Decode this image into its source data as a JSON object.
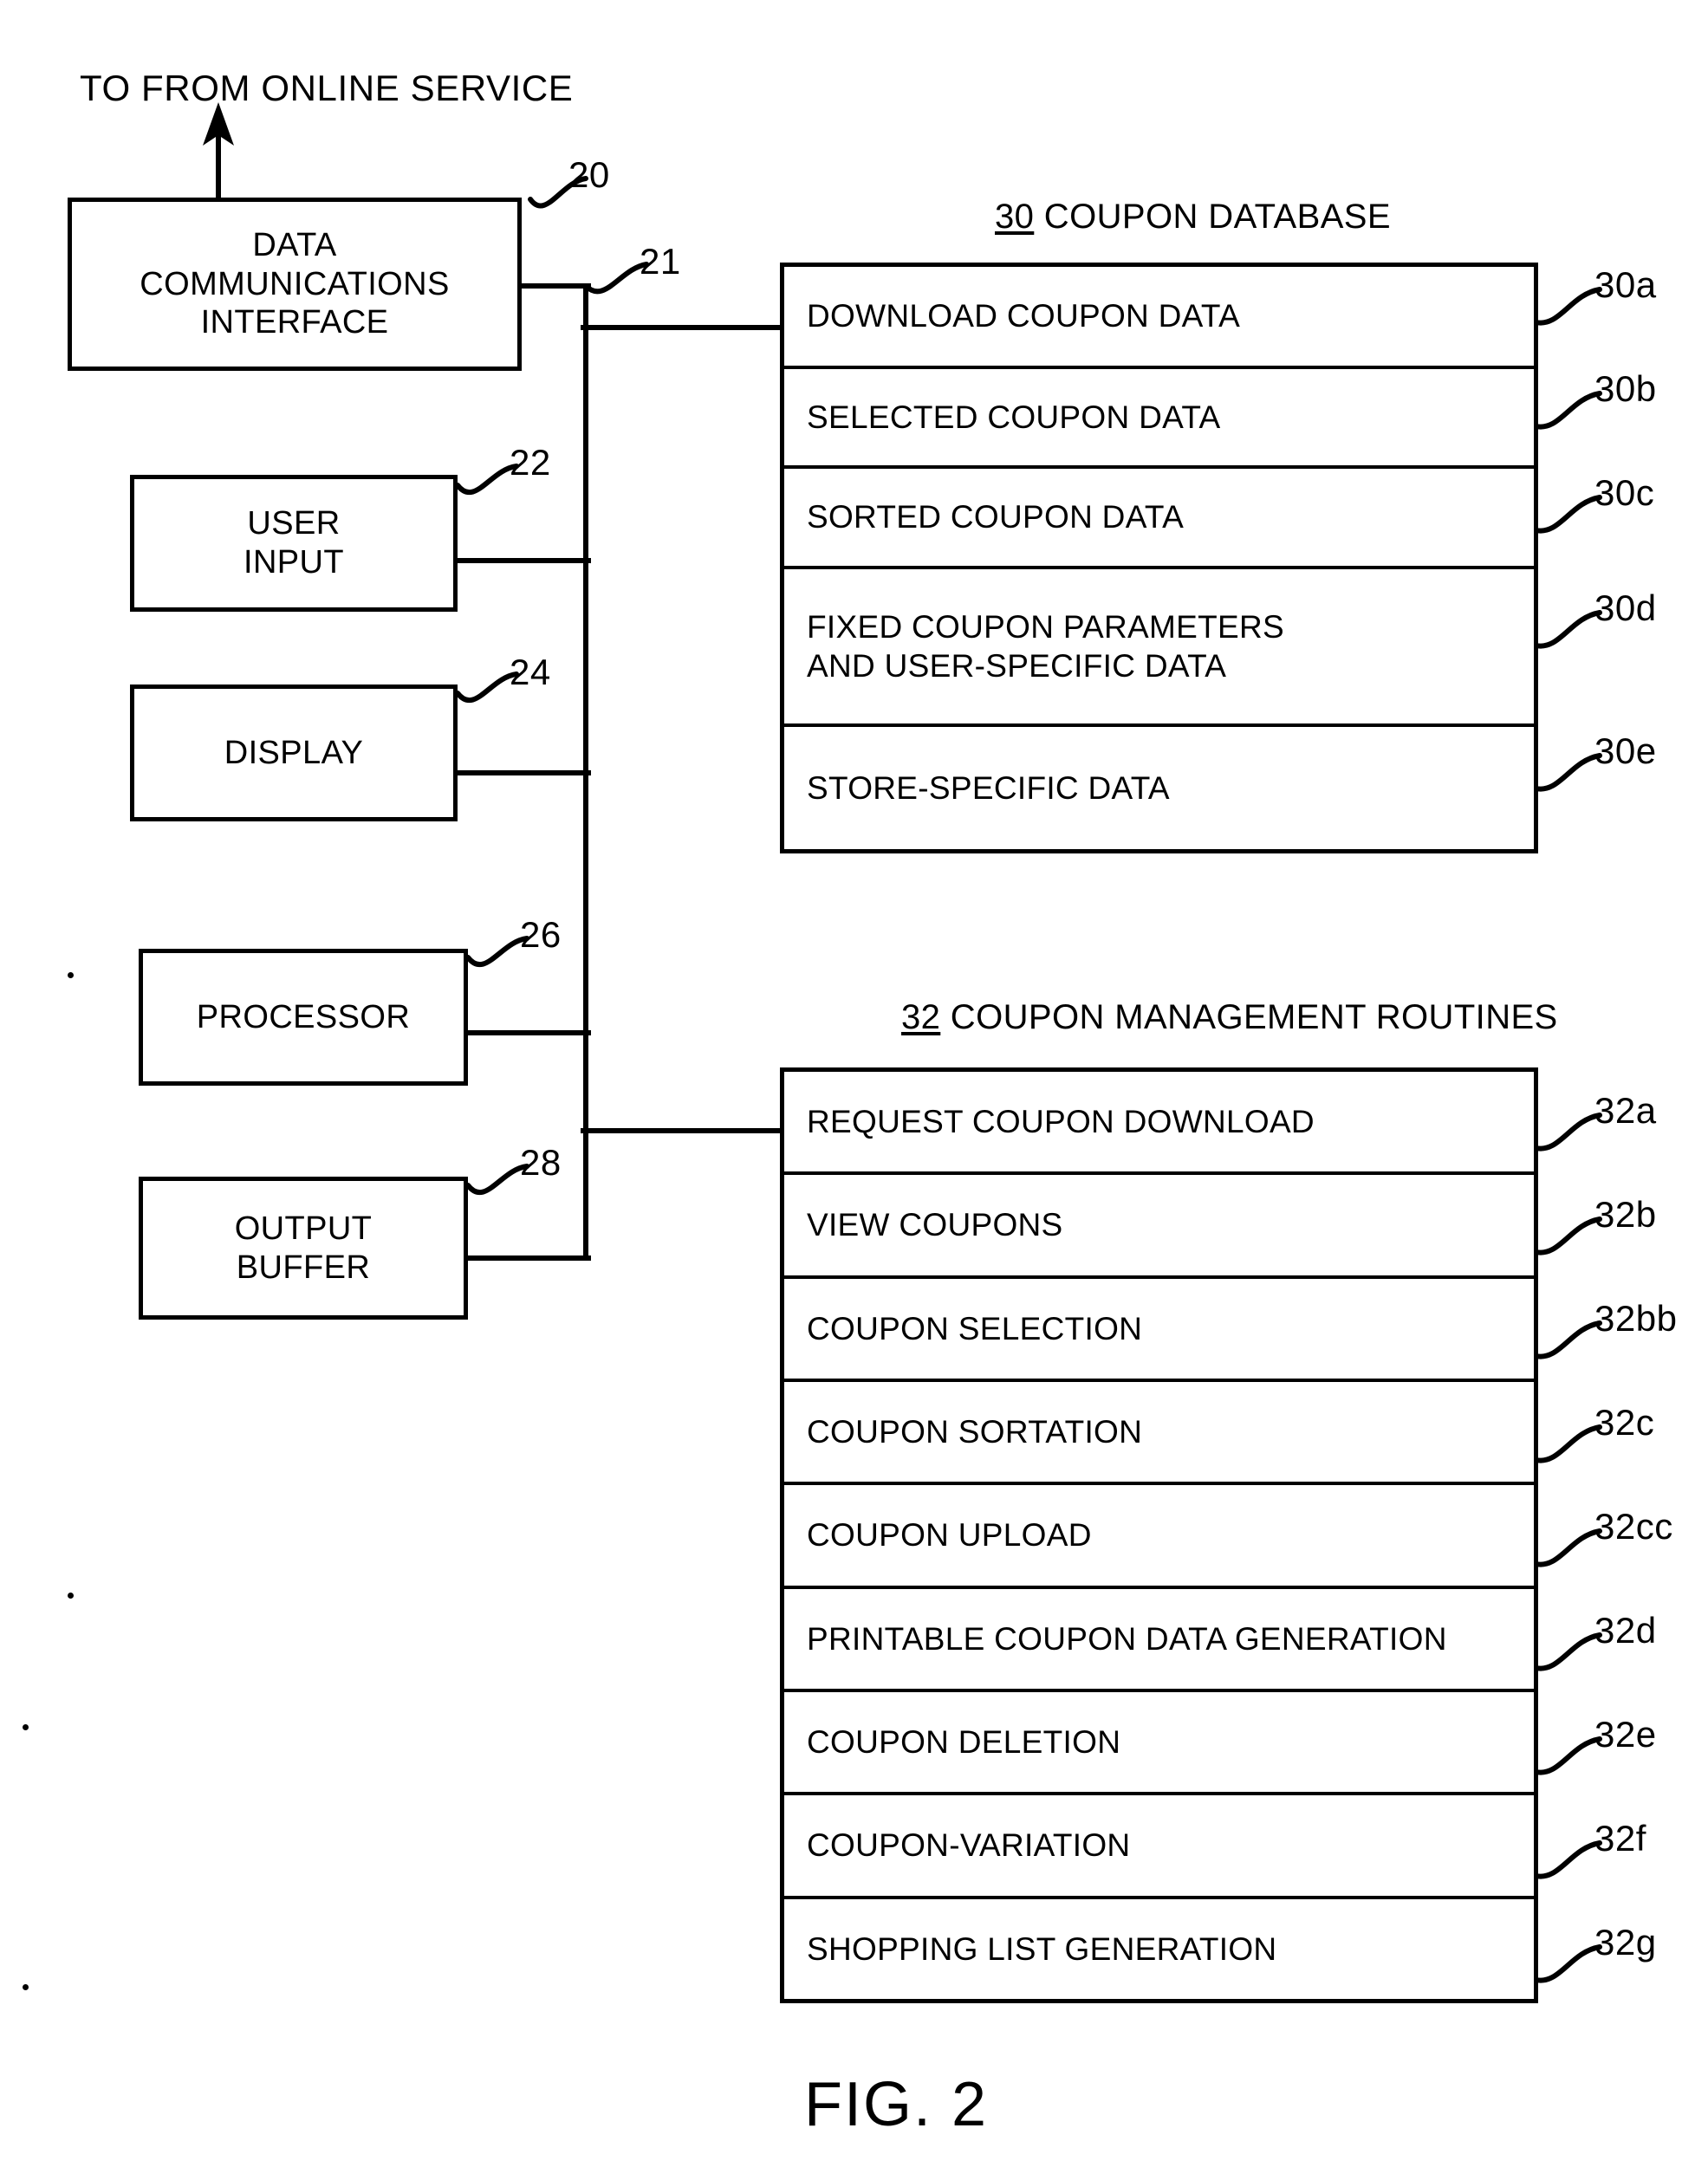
{
  "figure": {
    "caption": "FIG. 2",
    "top_annotation": "TO FROM ONLINE SERVICE"
  },
  "blocks": [
    {
      "id": "20",
      "label": "DATA\nCOMMUNICATIONS\nINTERFACE",
      "ref": "20"
    },
    {
      "id": "22",
      "label": "USER\nINPUT",
      "ref": "22"
    },
    {
      "id": "24",
      "label": "DISPLAY",
      "ref": "24"
    },
    {
      "id": "26",
      "label": "PROCESSOR",
      "ref": "26"
    },
    {
      "id": "28",
      "label": "OUTPUT\nBUFFER",
      "ref": "28"
    }
  ],
  "bus": {
    "ref": "21"
  },
  "coupon_database": {
    "header_number": "30",
    "header_text": " COUPON DATABASE",
    "rows": [
      {
        "label": "DOWNLOAD COUPON DATA",
        "ref": "30a"
      },
      {
        "label": "SELECTED COUPON DATA",
        "ref": "30b"
      },
      {
        "label": "SORTED COUPON DATA",
        "ref": "30c"
      },
      {
        "label": "FIXED COUPON PARAMETERS\nAND USER-SPECIFIC DATA",
        "ref": "30d"
      },
      {
        "label": "STORE-SPECIFIC DATA",
        "ref": "30e"
      }
    ]
  },
  "coupon_management_routines": {
    "header_number": "32",
    "header_text": " COUPON MANAGEMENT ROUTINES",
    "rows": [
      {
        "label": "REQUEST COUPON DOWNLOAD",
        "ref": "32a"
      },
      {
        "label": "VIEW COUPONS",
        "ref": "32b"
      },
      {
        "label": "COUPON SELECTION",
        "ref": "32bb"
      },
      {
        "label": "COUPON SORTATION",
        "ref": "32c"
      },
      {
        "label": "COUPON UPLOAD",
        "ref": "32cc"
      },
      {
        "label": "PRINTABLE COUPON DATA GENERATION",
        "ref": "32d"
      },
      {
        "label": "COUPON DELETION",
        "ref": "32e"
      },
      {
        "label": "COUPON-VARIATION",
        "ref": "32f"
      },
      {
        "label": "SHOPPING LIST GENERATION",
        "ref": "32g"
      }
    ]
  },
  "colors": {
    "ink": "#000000",
    "paper": "#ffffff"
  }
}
